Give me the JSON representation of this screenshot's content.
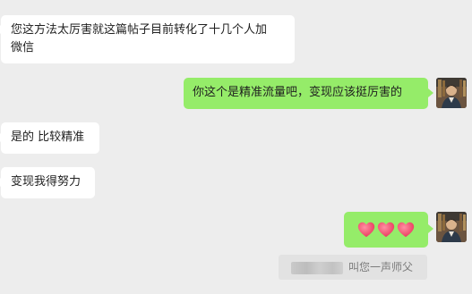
{
  "messages": [
    {
      "side": "in",
      "lines": [
        "您这方法太厉害就这篇帖子目前转化了十几个人加",
        "微信"
      ]
    },
    {
      "side": "out",
      "text": "你这个是精准流量吧，变现应该挺厉害的"
    },
    {
      "side": "in",
      "text": "是的 比较精准"
    },
    {
      "side": "in",
      "text": "变现我得努力"
    },
    {
      "side": "out",
      "emoji": "heart-emoji x3"
    }
  ],
  "quote": {
    "text": "叫您一声师父"
  },
  "colors": {
    "background": "#ededed",
    "incoming_bubble": "#ffffff",
    "outgoing_bubble": "#95ec69",
    "heart": "#ee4d6a",
    "quote_bg": "#e2e2e2"
  }
}
